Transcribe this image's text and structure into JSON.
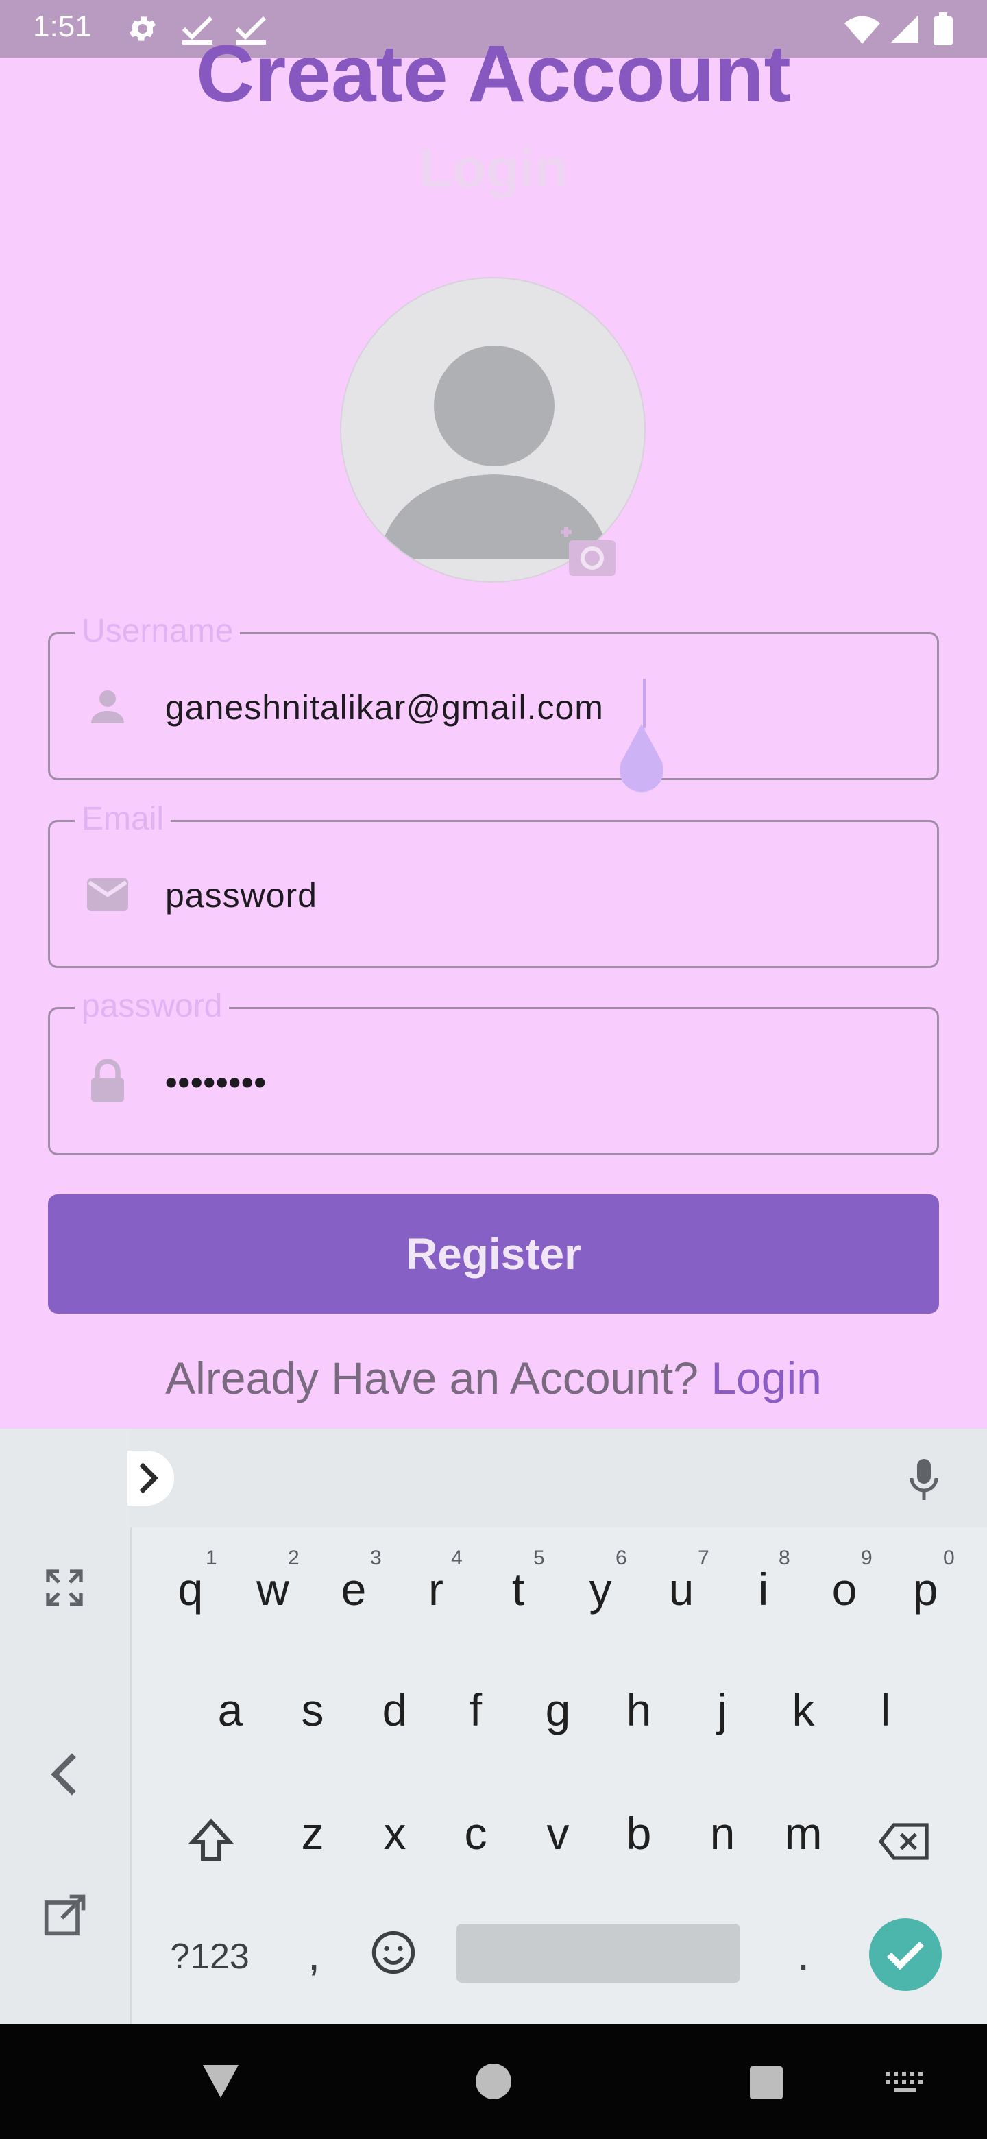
{
  "status_bar": {
    "time": "1:51",
    "icons": [
      "gear-icon",
      "check-icon",
      "check-icon",
      "wifi-icon",
      "signal-icon",
      "battery-icon"
    ]
  },
  "header": {
    "title": "Create Account",
    "subtitle": "Login"
  },
  "avatar": {
    "icon": "person-icon",
    "action_icon": "add-camera-icon"
  },
  "form": {
    "username": {
      "label": "Username",
      "value": "ganeshnitalikar@gmail.com",
      "icon": "person-icon"
    },
    "email": {
      "label": "Email",
      "value": "password",
      "icon": "mail-icon"
    },
    "password": {
      "label": "password",
      "value": "••••••••",
      "icon": "lock-icon"
    },
    "register_label": "Register",
    "footer_text": "Already Have an Account?",
    "footer_link": "Login"
  },
  "keyboard": {
    "row1": [
      "q",
      "w",
      "e",
      "r",
      "t",
      "y",
      "u",
      "i",
      "o",
      "p"
    ],
    "row1_hints": [
      "1",
      "2",
      "3",
      "4",
      "5",
      "6",
      "7",
      "8",
      "9",
      "0"
    ],
    "row2": [
      "a",
      "s",
      "d",
      "f",
      "g",
      "h",
      "j",
      "k",
      "l"
    ],
    "row3": [
      "z",
      "x",
      "c",
      "v",
      "b",
      "n",
      "m"
    ],
    "symbols_label": "?123",
    "comma": ",",
    "period": "."
  },
  "colors": {
    "background": "#f9ccfe",
    "accent": "#8660c4",
    "title": "#8658c0",
    "keyboard_done": "#4db6ac"
  }
}
